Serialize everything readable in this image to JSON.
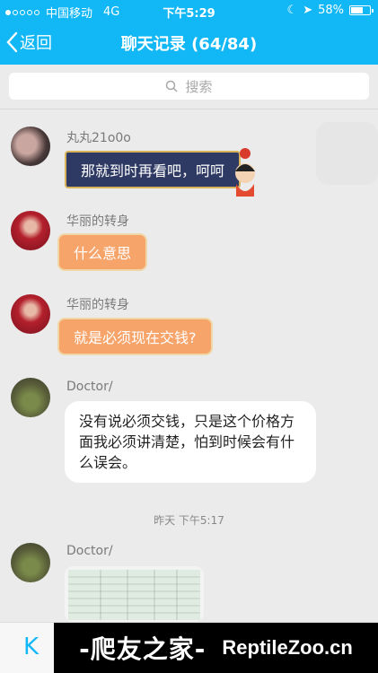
{
  "status": {
    "carrier": "中国移动",
    "network": "4G",
    "time": "下午5:29",
    "battery": "58%",
    "battery_level": 0.58
  },
  "nav": {
    "back_label": "返回",
    "title": "聊天记录 (64/84)"
  },
  "search": {
    "placeholder": "搜索"
  },
  "messages": [
    {
      "sender": "丸丸21o0o",
      "text": "那就到时再看吧，呵呵"
    },
    {
      "sender": "华丽的转身",
      "text": "什么意思"
    },
    {
      "sender": "华丽的转身",
      "text": "就是必须现在交钱?"
    },
    {
      "sender": "Doctor/",
      "text": "没有说必须交钱，只是这个价格方面我必须讲清楚，怕到时候会有什么误会。"
    },
    {
      "sender": "Doctor/",
      "text": ""
    }
  ],
  "timestamp": "昨天 下午5:17",
  "bottom": {
    "k_icon": "keyboard-icon"
  },
  "watermark": {
    "cn": "-爬友之家-",
    "en": "ReptileZoo.cn"
  },
  "colors": {
    "accent": "#12b7f5",
    "bubble_orange": "#f7a46b",
    "bubble_dark": "#2e3a63"
  }
}
